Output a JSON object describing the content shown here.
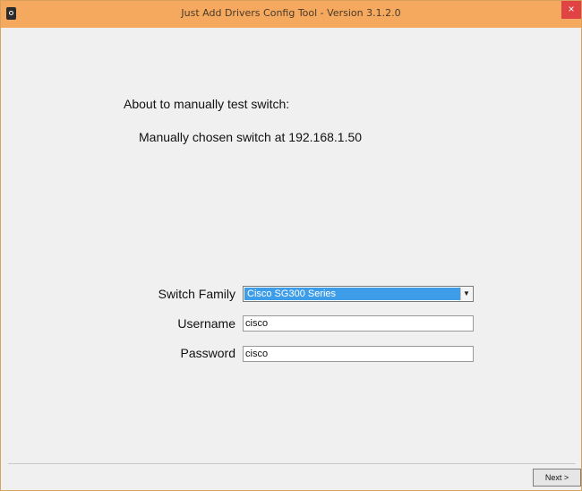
{
  "window": {
    "title": "Just Add Drivers Config Tool - Version 3.1.2.0",
    "close_label": "×"
  },
  "content": {
    "heading": "About to manually test switch:",
    "subheading": "Manually chosen switch at 192.168.1.50"
  },
  "form": {
    "switch_family_label": "Switch Family",
    "switch_family_value": "Cisco SG300 Series",
    "username_label": "Username",
    "username_value": "cisco",
    "password_label": "Password",
    "password_value": "cisco"
  },
  "footer": {
    "next_label": "Next >"
  },
  "colors": {
    "titlebar": "#f5a95e",
    "selection": "#3e9de8",
    "close_button": "#e04343"
  },
  "icons": {
    "app": "app-icon",
    "close": "close-icon",
    "dropdown": "chevron-down-icon"
  }
}
